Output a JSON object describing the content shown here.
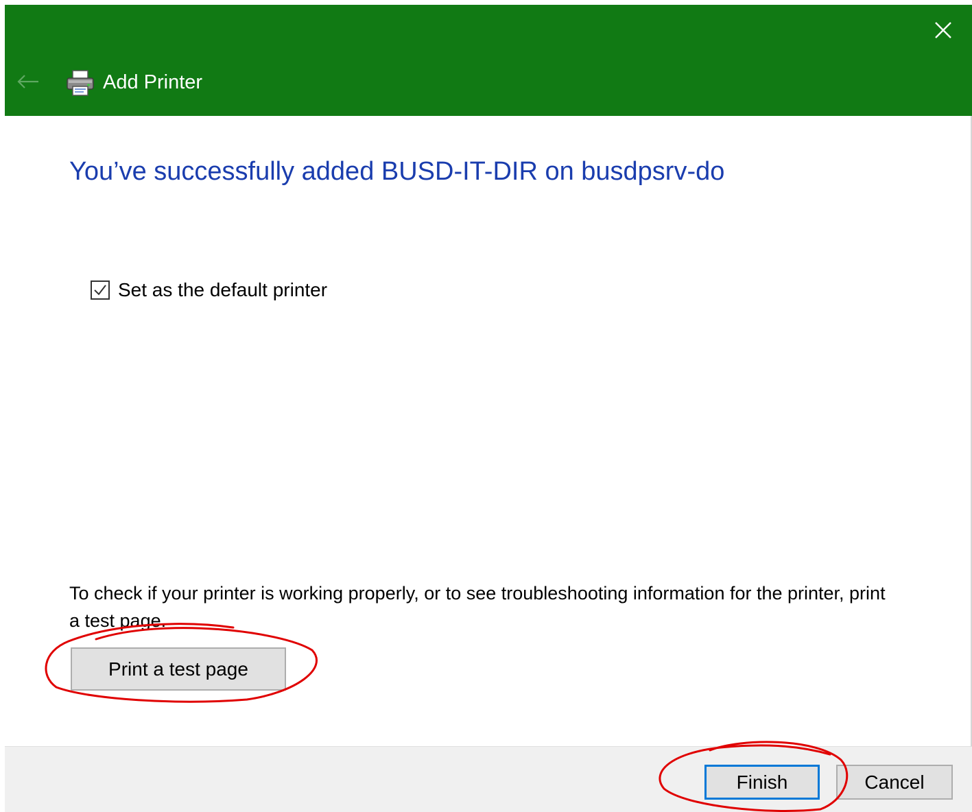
{
  "window": {
    "title": "Add Printer",
    "titlebar_color": "#117a14",
    "icons": {
      "back": "back-arrow-icon",
      "printer": "printer-icon",
      "close": "close-icon"
    }
  },
  "content": {
    "heading": "You’ve successfully added BUSD-IT-DIR on busdpsrv-do",
    "heading_color": "#1a3dae",
    "default_printer": {
      "label": "Set as the default printer",
      "checked": true
    },
    "info_text": "To check if your printer is working properly, or to see troubleshooting information for the printer, print a test page.",
    "test_page_button": "Print a test page"
  },
  "footer": {
    "finish_button": "Finish",
    "cancel_button": "Cancel",
    "focus_color": "#0078d7"
  },
  "annotations": {
    "color": "#e00000"
  }
}
